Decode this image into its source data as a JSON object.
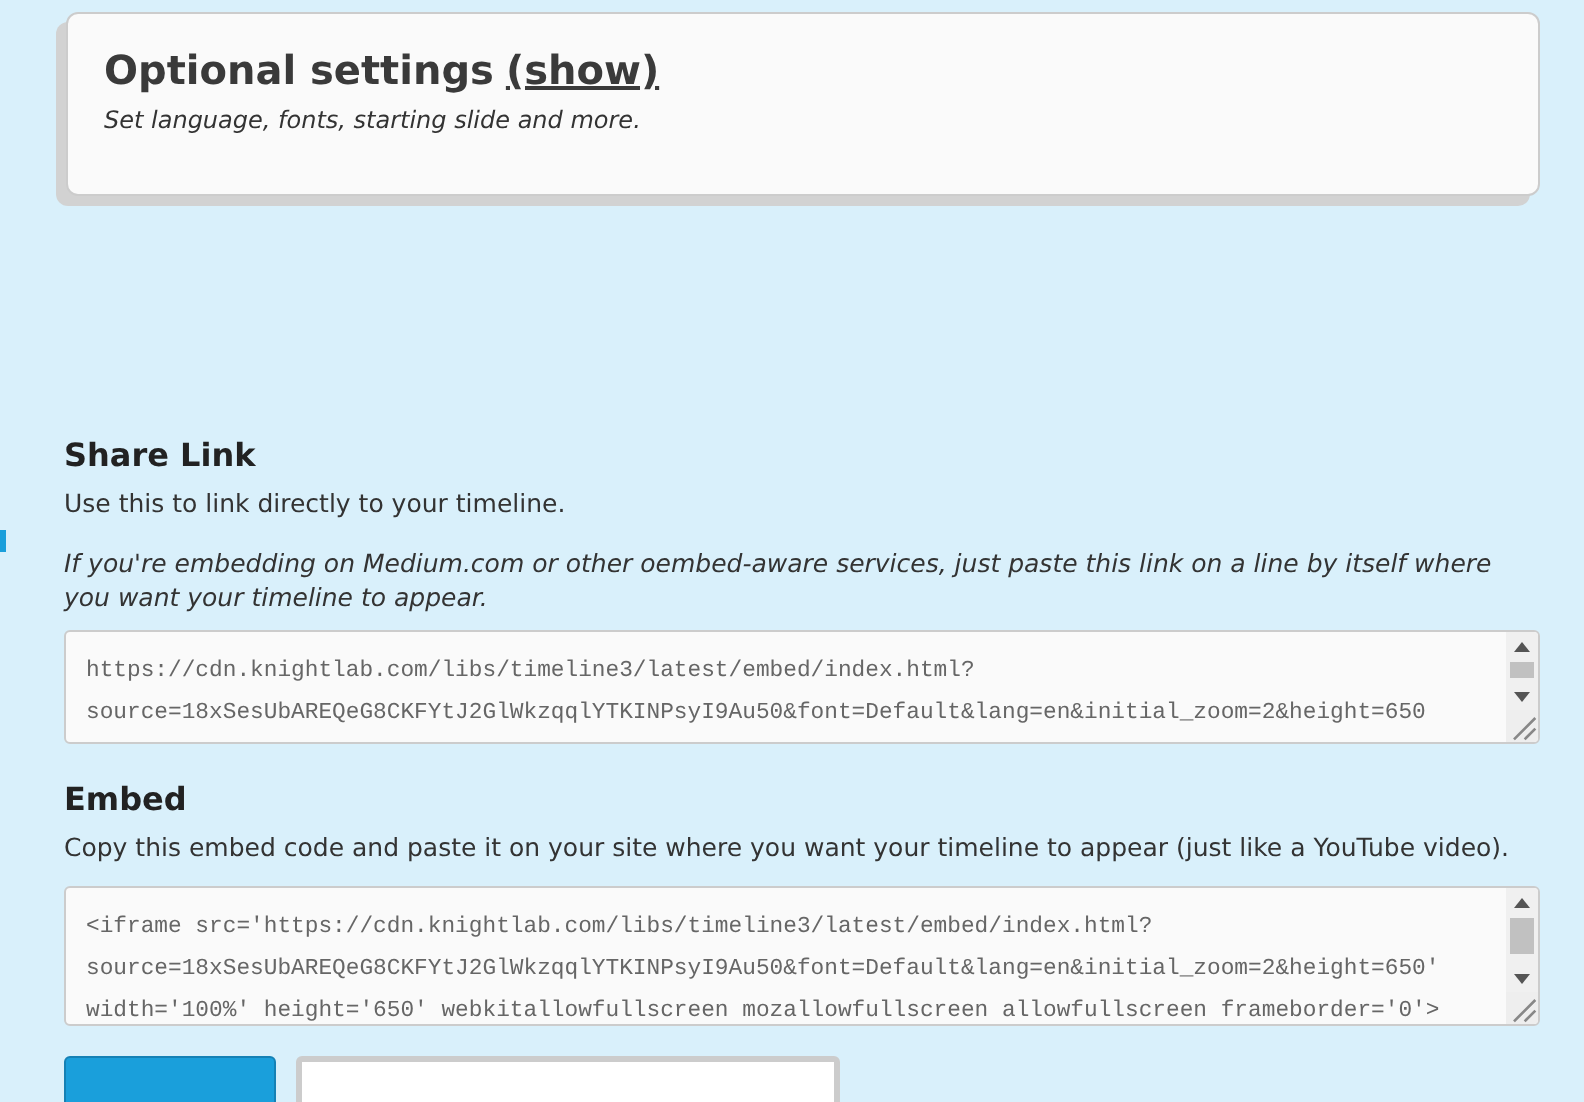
{
  "optional_settings": {
    "title": "Optional settings",
    "toggle_link": "(show)",
    "description": "Set language, fonts, starting slide and more."
  },
  "share_link": {
    "heading": "Share Link",
    "description": "Use this to link directly to your timeline.",
    "note": "If you're embedding on Medium.com or other oembed-aware services, just paste this link on a line by itself where you want your timeline to appear.",
    "code_lines": [
      "https://cdn.knightlab.com/libs/timeline3/latest/embed/index.html?",
      "source=18xSesUbAREQeG8CKFYtJ2GlWkzqqlYTKINPsyI9Au50&font=Default&lang=en&initial_zoom=2&height=650"
    ]
  },
  "embed": {
    "heading": "Embed",
    "description": "Copy this embed code and paste it on your site where you want your timeline to appear (just like a YouTube video).",
    "code_lines": [
      "<iframe src='https://cdn.knightlab.com/libs/timeline3/latest/embed/index.html?",
      "source=18xSesUbAREQeG8CKFYtJ2GlWkzqqlYTKINPsyI9Au50&font=Default&lang=en&initial_zoom=2&height=650'",
      "width='100%' height='650' webkitallowfullscreen mozallowfullscreen allowfullscreen frameborder='0'>"
    ]
  }
}
